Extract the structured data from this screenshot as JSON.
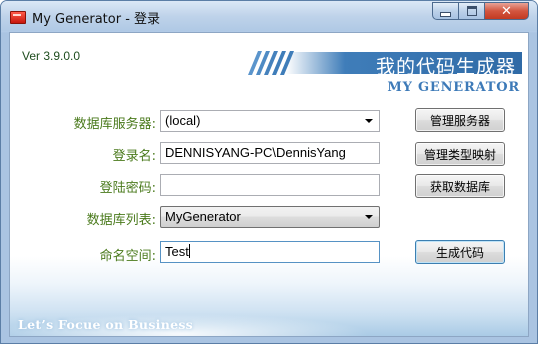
{
  "window": {
    "title": "My Generator - 登录",
    "controls": {
      "minimize": "minimize",
      "maximize": "maximize",
      "close": "✕"
    }
  },
  "header": {
    "version": "Ver 3.9.0.0",
    "banner_cn": "我的代码生成器",
    "banner_en": "MY GENERATOR"
  },
  "form": {
    "server_label": "数据库服务器:",
    "server_value": "(local)",
    "login_label": "登录名:",
    "login_value": "DENNISYANG-PC\\DennisYang",
    "password_label": "登陆密码:",
    "password_value": "",
    "dblist_label": "数据库列表:",
    "dblist_value": "MyGenerator",
    "namespace_label": "命名空间:",
    "namespace_value": "Test"
  },
  "buttons": {
    "manage_server": "管理服务器",
    "manage_type_map": "管理类型映射",
    "get_database": "获取数据库",
    "generate_code": "生成代码"
  },
  "footer": {
    "slogan": "Let’s Focue on Business"
  },
  "colors": {
    "label_green": "#4a7a1c",
    "banner_blue": "#3f7db9",
    "close_red": "#c23a22"
  }
}
